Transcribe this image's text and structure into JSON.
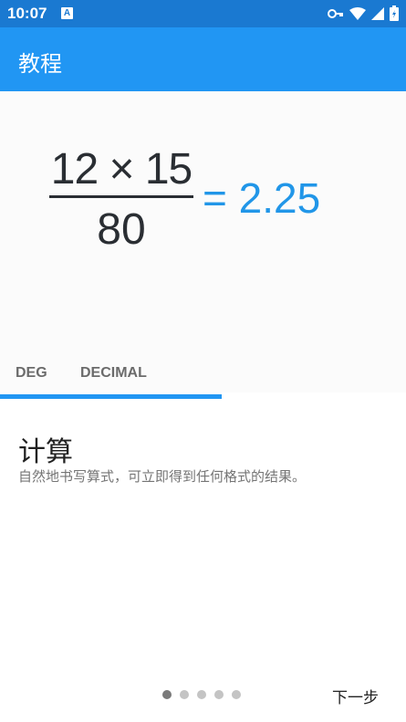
{
  "status_bar": {
    "time": "10:07",
    "notification_letter": "A",
    "icons": [
      "key-icon",
      "wifi-icon",
      "cell-signal-icon",
      "battery-icon"
    ]
  },
  "app_bar": {
    "title": "教程"
  },
  "illustration": {
    "numerator": "12 × 15",
    "denominator": "80",
    "result": "= 2.25",
    "result_color": "#2196e8",
    "tabs": [
      "DEG",
      "DECIMAL"
    ]
  },
  "feature": {
    "title": "计算",
    "description": "自然地书写算式，可立即得到任何格式的结果。"
  },
  "pager": {
    "total": 5,
    "current": 1
  },
  "footer": {
    "next_label": "下一步"
  },
  "colors": {
    "status_bar": "#1a79d1",
    "app_bar": "#2196f3",
    "accent": "#2196f3"
  }
}
